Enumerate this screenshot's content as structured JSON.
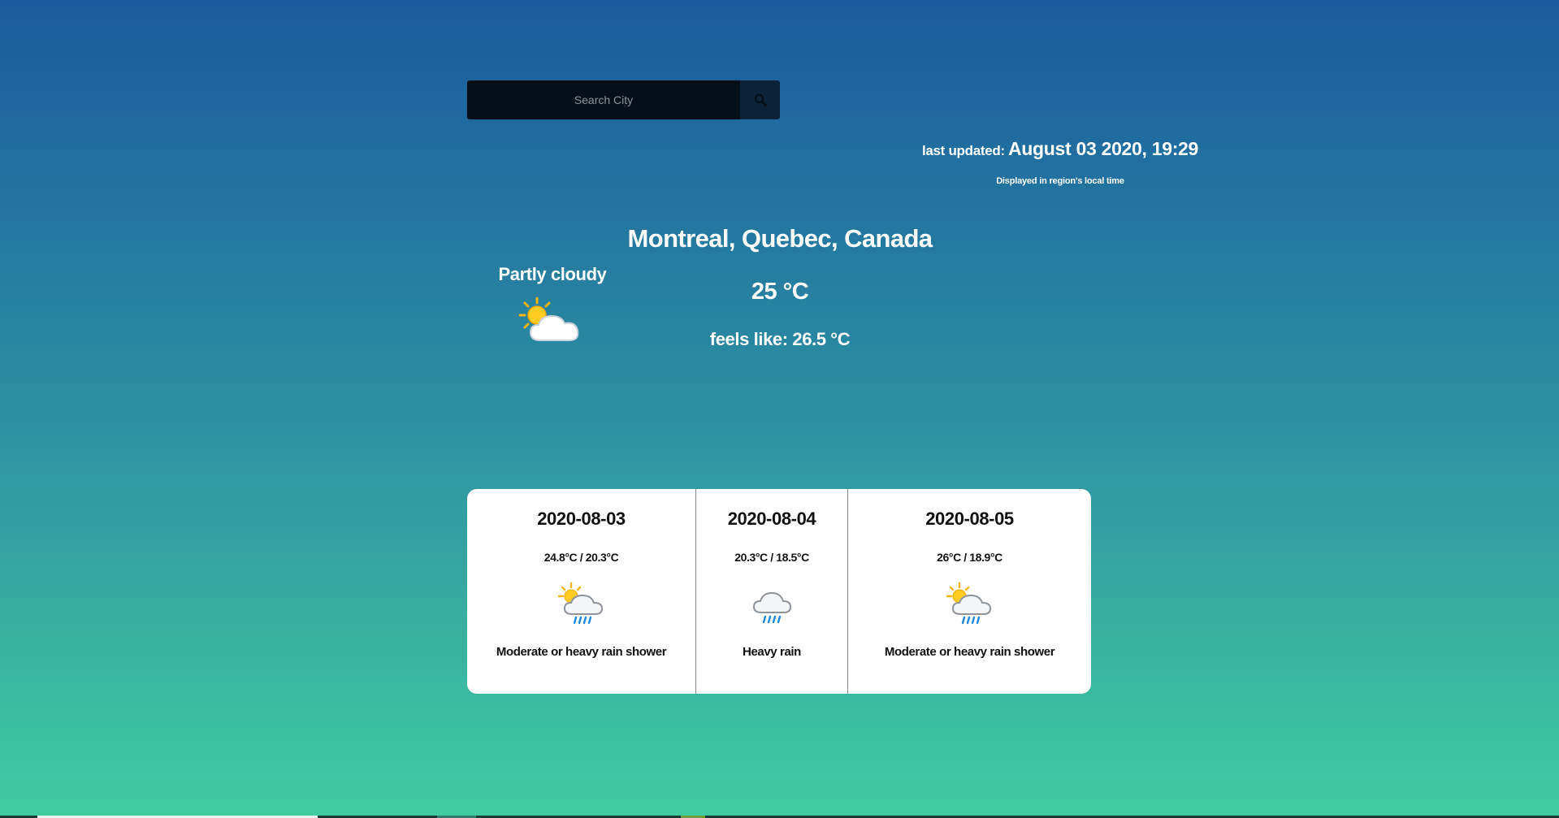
{
  "search": {
    "placeholder": "Search City",
    "button_icon": "search-icon"
  },
  "last_updated": {
    "label": "last updated:",
    "value": "August 03 2020, 19:29",
    "note": "Displayed in region's local time"
  },
  "current": {
    "location": "Montreal, Quebec, Canada",
    "condition": "Partly cloudy",
    "condition_icon": "partly-cloudy-icon",
    "temperature": "25 °C",
    "feels_like": "feels like: 26.5 °C"
  },
  "forecast": [
    {
      "date": "2020-08-03",
      "temps": "24.8°C / 20.3°C",
      "icon": "sun-cloud-rain-icon",
      "description": "Moderate or heavy rain shower"
    },
    {
      "date": "2020-08-04",
      "temps": "20.3°C / 18.5°C",
      "icon": "cloud-rain-icon",
      "description": "Heavy rain"
    },
    {
      "date": "2020-08-05",
      "temps": "26°C / 18.9°C",
      "icon": "sun-cloud-rain-icon",
      "description": "Moderate or heavy rain shower"
    }
  ],
  "colors": {
    "gradient_top": "#1a5a9e",
    "gradient_bottom": "#41cca0",
    "search_bg": "#050f19",
    "search_button_bg": "#0b2238",
    "card_bg": "#ffffff"
  }
}
